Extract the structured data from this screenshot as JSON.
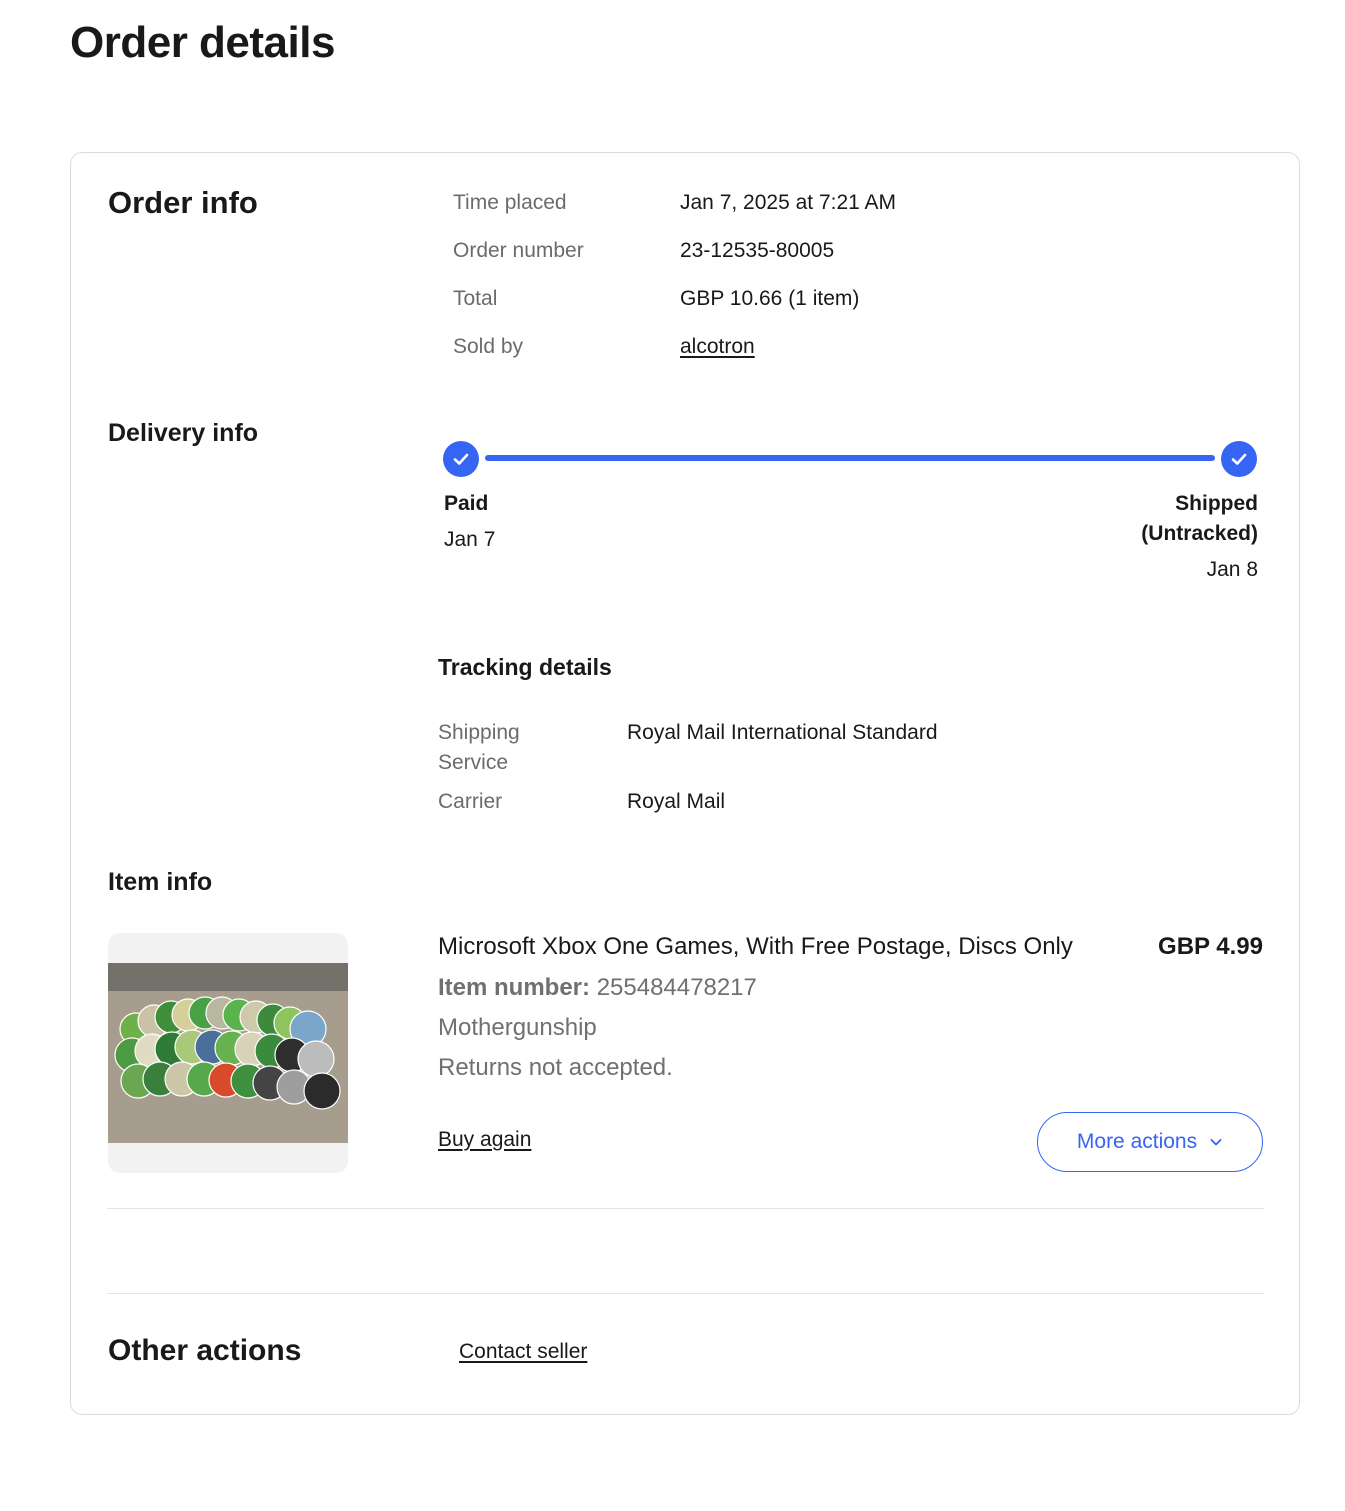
{
  "page": {
    "title": "Order details"
  },
  "order_info": {
    "heading": "Order info",
    "rows": [
      {
        "label": "Time placed",
        "value": "Jan 7, 2025 at 7:21 AM"
      },
      {
        "label": "Order number",
        "value": "23-12535-80005"
      },
      {
        "label": "Total",
        "value": "GBP 10.66 (1 item)"
      },
      {
        "label": "Sold by",
        "value": "alcotron"
      }
    ]
  },
  "delivery_info": {
    "heading": "Delivery info",
    "progress_fraction": 1.0,
    "accent_color": "#3665f3",
    "steps": [
      {
        "title": "Paid",
        "date": "Jan 7",
        "icon": "check-icon"
      },
      {
        "title": "Shipped",
        "title2": "(Untracked)",
        "date": "Jan 8",
        "icon": "check-icon"
      }
    ],
    "tracking": {
      "heading": "Tracking details",
      "rows": [
        {
          "label_line1": "Shipping",
          "label_line2": "Service",
          "value": "Royal Mail International Standard"
        },
        {
          "label": "Carrier",
          "value": "Royal Mail"
        }
      ]
    }
  },
  "item_info": {
    "heading": "Item info",
    "item": {
      "title": "Microsoft Xbox One Games, With Free Postage, Discs Only",
      "price": "GBP 4.99",
      "item_number_label": "Item number:",
      "item_number": "255484478217",
      "variant": "Mothergunship",
      "returns": "Returns not accepted.",
      "buy_again": "Buy again",
      "more_actions": "More actions"
    }
  },
  "other_actions": {
    "heading": "Other actions",
    "contact_seller": "Contact seller"
  }
}
